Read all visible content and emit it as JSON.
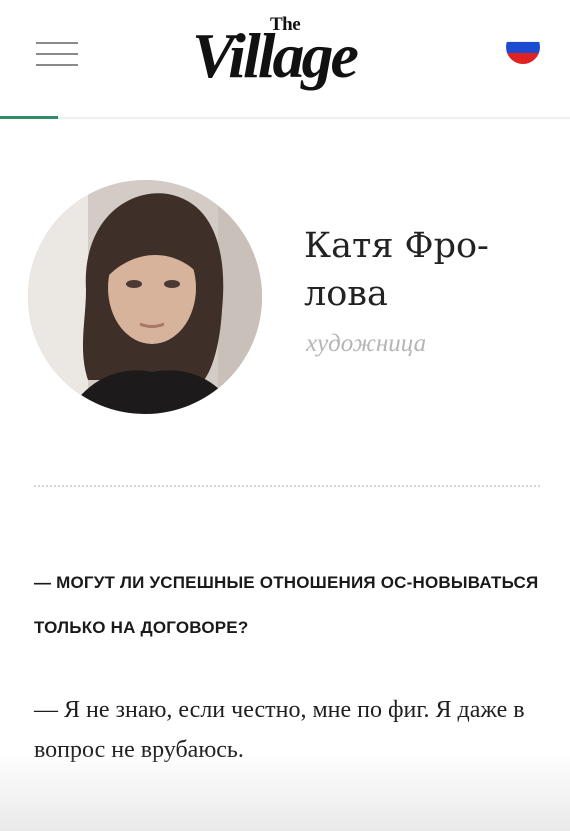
{
  "header": {
    "logo_small": "The",
    "logo_main": "Village",
    "menu_icon": "hamburger-menu-icon",
    "language_flag": "russia-flag-icon",
    "accent_color": "#2f8c69"
  },
  "author": {
    "name": "Катя Фро-лова",
    "role": "художница"
  },
  "interview": {
    "question": "— МОГУТ ЛИ УСПЕШНЫЕ ОТНОШЕНИЯ ОС-НОВЫВАТЬСЯ ТОЛЬКО НА ДОГОВОРЕ?",
    "answer": "— Я не знаю, если честно, мне по фиг. Я даже в вопрос не врубаюсь."
  },
  "colors": {
    "flag_white": "#ffffff",
    "flag_blue": "#1c4bd1",
    "flag_red": "#e02222",
    "role_text": "#b5b5b5"
  }
}
